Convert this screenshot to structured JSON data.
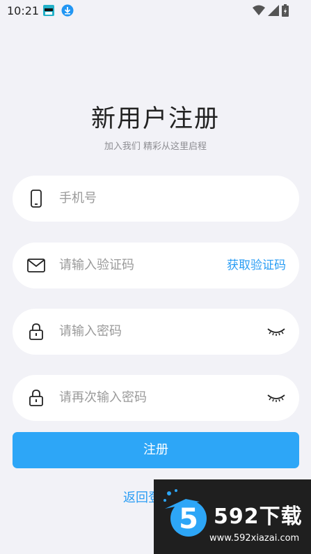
{
  "status_bar": {
    "time": "10:21"
  },
  "header": {
    "title": "新用户注册",
    "subtitle": "加入我们 精彩从这里启程"
  },
  "form": {
    "phone": {
      "placeholder": "手机号"
    },
    "code": {
      "placeholder": "请输入验证码",
      "action_label": "获取验证码"
    },
    "password": {
      "placeholder": "请输入密码"
    },
    "confirm_password": {
      "placeholder": "请再次输入密码"
    }
  },
  "register_button": "注册",
  "back_link": "返回登",
  "watermark": {
    "brand": "592下载",
    "url": "www.592xiazai.com"
  },
  "colors": {
    "accent": "#2da6f7",
    "link": "#2a9df4",
    "background": "#f2f2f7"
  },
  "icons": [
    "phone-icon",
    "mail-icon",
    "lock-icon",
    "eye-closed-icon",
    "wifi-icon",
    "signal-icon",
    "battery-icon",
    "download-icon"
  ]
}
